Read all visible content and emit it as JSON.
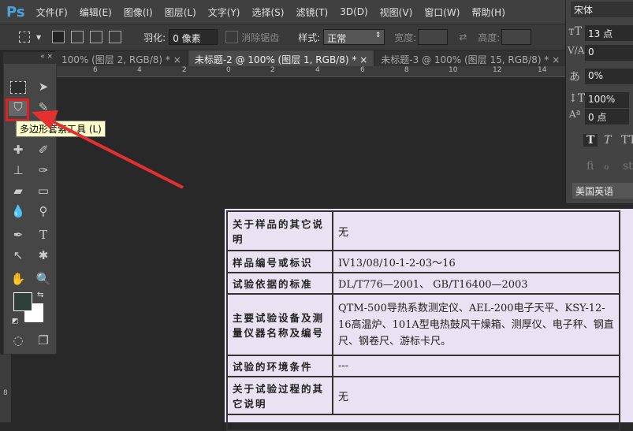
{
  "app": {
    "logo": "Ps"
  },
  "menu": [
    "文件(F)",
    "编辑(E)",
    "图像(I)",
    "图层(L)",
    "文字(Y)",
    "选择(S)",
    "滤镜(T)",
    "3D(D)",
    "视图(V)",
    "窗口(W)",
    "帮助(H)"
  ],
  "options": {
    "feather_label": "羽化:",
    "feather_value": "0 像素",
    "antialias_label": "消除锯齿",
    "style_label": "样式:",
    "style_value": "正常",
    "width_label": "宽度:",
    "height_label": "高度:"
  },
  "tabs": [
    {
      "label": "100% (图层 2, RGB/8) *",
      "close": "×"
    },
    {
      "label": "未标题-2 @ 100% (图层 1, RGB/8) *",
      "close": "×"
    },
    {
      "label": "未标题-3 @ 100% (图层 15, RGB/8) *",
      "close": "×"
    }
  ],
  "ruler": [
    "6",
    "4",
    "2",
    "0",
    "2",
    "4",
    "6",
    "8",
    "10",
    "12",
    "14"
  ],
  "vruler": "8",
  "toolbox": {
    "collapse": "«  ×",
    "tooltip": "多边形套索工具 (L)"
  },
  "colors": {
    "foreground": "#2f3f3a",
    "background": "#ffffff",
    "highlight": "#e02020"
  },
  "char_panel": {
    "font": "宋体",
    "size": "13 点",
    "kerning": "0",
    "tracking": "0%",
    "vscale": "100%",
    "baseline": "0 点",
    "language": "美国英语",
    "styles": [
      "T",
      "T",
      "TT"
    ],
    "opentype": [
      "fi",
      "ℴ",
      "st"
    ]
  },
  "document": {
    "rows": [
      {
        "key": "关于样品的其它说明",
        "value": "无"
      },
      {
        "key": "样品编号或标识",
        "value": "IV13/08/10-1-2-03～16"
      },
      {
        "key": "试验依据的标准",
        "value": "DL/T776—2001、 GB/T16400—2003"
      },
      {
        "key": "主要试验设备及测量仪器名称及编号",
        "value": "QTM-500导热系数测定仪、AEL-200电子天平、KSY-12-16高温炉、101A型电热鼓风干燥箱、测厚仪、电子秤、钢直尺、钢卷尺、游标卡尺。"
      },
      {
        "key": "试验的环境条件",
        "value": "---"
      },
      {
        "key": "关于试验过程的其它说明",
        "value": "无"
      }
    ]
  }
}
